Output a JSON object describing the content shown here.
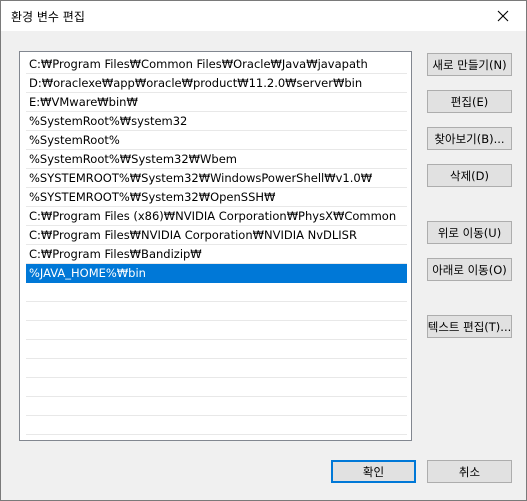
{
  "window": {
    "title": "환경 변수 편집"
  },
  "icons": {
    "close": "close-icon"
  },
  "paths": [
    "C:₩Program Files₩Common Files₩Oracle₩Java₩javapath",
    "D:₩oraclexe₩app₩oracle₩product₩11.2.0₩server₩bin",
    "E:₩VMware₩bin₩",
    "%SystemRoot%₩system32",
    "%SystemRoot%",
    "%SystemRoot%₩System32₩Wbem",
    "%SYSTEMROOT%₩System32₩WindowsPowerShell₩v1.0₩",
    "%SYSTEMROOT%₩System32₩OpenSSH₩",
    "C:₩Program Files (x86)₩NVIDIA Corporation₩PhysX₩Common",
    "C:₩Program Files₩NVIDIA Corporation₩NVIDIA NvDLISR",
    "C:₩Program Files₩Bandizip₩",
    "%JAVA_HOME%₩bin"
  ],
  "selected_index": 11,
  "buttons": {
    "new": "새로 만들기(N)",
    "edit": "편집(E)",
    "browse": "찾아보기(B)...",
    "delete": "삭제(D)",
    "move_up": "위로 이동(U)",
    "move_down": "아래로 이동(O)",
    "edit_text": "텍스트 편집(T)...",
    "ok": "확인",
    "cancel": "취소"
  },
  "colors": {
    "selection": "#0078d7",
    "dialog_bg": "#f0f0f0"
  }
}
